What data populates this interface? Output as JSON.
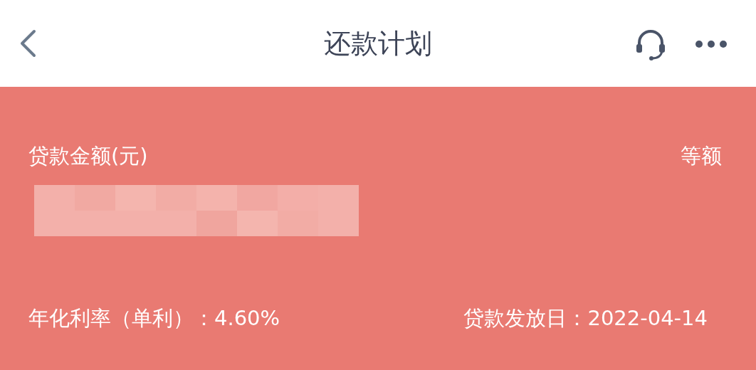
{
  "header": {
    "title": "还款计划"
  },
  "loan": {
    "amount_label": "贷款金额(元)",
    "repayment_type": "等额",
    "amount_hidden": true,
    "rate": "年化利率（单利）：4.60%",
    "issue_date": "贷款发放日：2022-04-14"
  }
}
